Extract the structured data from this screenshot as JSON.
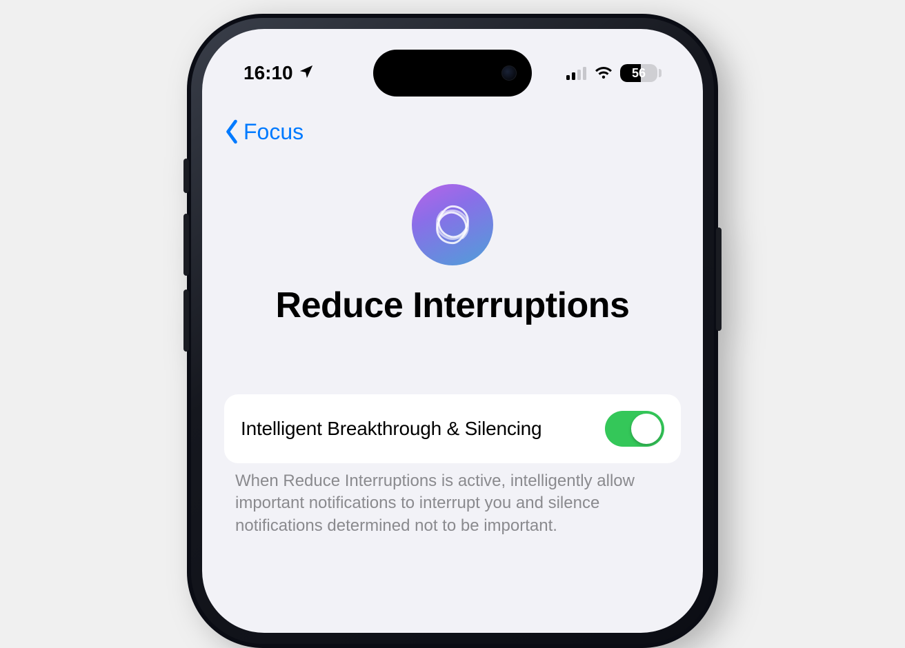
{
  "statusbar": {
    "time": "16:10",
    "battery_percent": "56"
  },
  "nav": {
    "back_label": "Focus"
  },
  "hero": {
    "title": "Reduce Interruptions"
  },
  "setting": {
    "label": "Intelligent Breakthrough & Silencing",
    "enabled": true,
    "footer": "When Reduce Interruptions is active, intelligently allow important notifications to interrupt you and silence notifications determined not to be important."
  },
  "colors": {
    "accent": "#007aff",
    "toggle_on": "#34c759",
    "screen_bg": "#f2f2f7"
  }
}
